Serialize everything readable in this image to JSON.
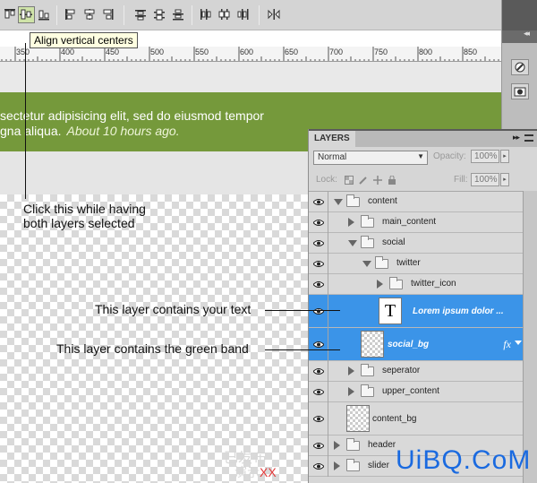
{
  "toolbar": {
    "tooltip": "Align vertical centers"
  },
  "ruler": {
    "labels": [
      "350",
      "400",
      "450",
      "500",
      "550",
      "600",
      "650",
      "700",
      "750",
      "800",
      "850"
    ]
  },
  "canvas": {
    "band_line1": "sectetur adipisicing elit, sed do eiusmod tempor",
    "band_line2": "gna aliqua.",
    "band_time": "About 10 hours ago.",
    "band_color": "#75993b"
  },
  "annotations": {
    "click_note": "Click this while having\nboth layers selected",
    "text_layer_note": "This layer contains your text",
    "band_layer_note": "This layer contains the green band"
  },
  "layers_panel": {
    "title": "LAYERS",
    "blend_mode": "Normal",
    "opacity_label": "Opacity:",
    "opacity_value": "100%",
    "lock_label": "Lock:",
    "fill_label": "Fill:",
    "fill_value": "100%",
    "layers": [
      {
        "name": "content",
        "kind": "group",
        "expanded": true,
        "indent": 0
      },
      {
        "name": "main_content",
        "kind": "group",
        "expanded": false,
        "indent": 1
      },
      {
        "name": "social",
        "kind": "group",
        "expanded": true,
        "indent": 1
      },
      {
        "name": "twitter",
        "kind": "group",
        "expanded": true,
        "indent": 2
      },
      {
        "name": "twitter_icon",
        "kind": "group",
        "expanded": false,
        "indent": 3
      },
      {
        "name": "Lorem ipsum dolor ...",
        "kind": "text",
        "selected": true
      },
      {
        "name": "social_bg",
        "kind": "pixel",
        "selected": true,
        "fx": "fx"
      },
      {
        "name": "seperator",
        "kind": "group",
        "expanded": false,
        "indent": 1
      },
      {
        "name": "upper_content",
        "kind": "group",
        "expanded": false,
        "indent": 1
      },
      {
        "name": "content_bg",
        "kind": "pixel"
      },
      {
        "name": "header",
        "kind": "group",
        "expanded": false,
        "indent": 0
      },
      {
        "name": "slider",
        "kind": "group",
        "expanded": false,
        "indent": 0
      }
    ],
    "selection_color": "#3b94e8"
  },
  "watermark": {
    "brand": "UiBQ.CoM",
    "site_a": "已发布",
    "site_b": "演示",
    "site_xx": "XX"
  }
}
